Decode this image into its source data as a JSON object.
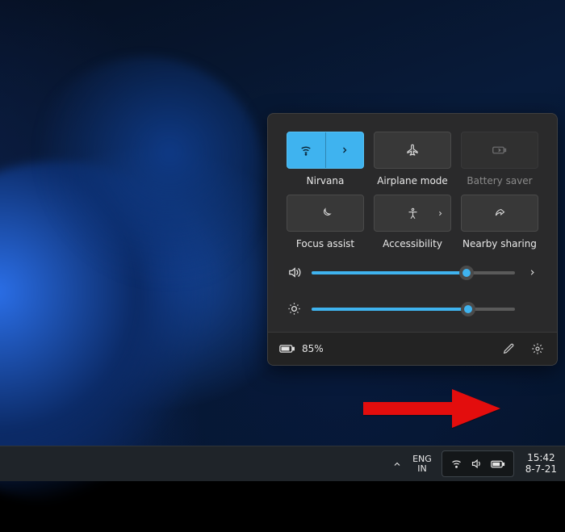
{
  "quick_settings": {
    "tiles": [
      {
        "id": "wifi",
        "label": "Nirvana",
        "icon": "wifi-icon",
        "active": true,
        "split": true,
        "disabled": false
      },
      {
        "id": "airplane",
        "label": "Airplane mode",
        "icon": "airplane-icon",
        "active": false,
        "split": false,
        "disabled": false
      },
      {
        "id": "battery_saver",
        "label": "Battery saver",
        "icon": "battery-saver-icon",
        "active": false,
        "split": false,
        "disabled": true
      },
      {
        "id": "focus_assist",
        "label": "Focus assist",
        "icon": "moon-icon",
        "active": false,
        "split": false,
        "disabled": false
      },
      {
        "id": "accessibility",
        "label": "Accessibility",
        "icon": "accessibility-icon",
        "active": false,
        "split": false,
        "disabled": false,
        "chevron": true
      },
      {
        "id": "nearby",
        "label": "Nearby sharing",
        "icon": "share-icon",
        "active": false,
        "split": false,
        "disabled": false
      }
    ],
    "volume": {
      "percent": 76
    },
    "brightness": {
      "percent": 77
    },
    "battery": {
      "text": "85%"
    }
  },
  "taskbar": {
    "language": {
      "line1": "ENG",
      "line2": "IN"
    },
    "clock": {
      "time": "15:42",
      "date": "8-7-21"
    }
  },
  "colors": {
    "accent": "#3fb3ef"
  }
}
